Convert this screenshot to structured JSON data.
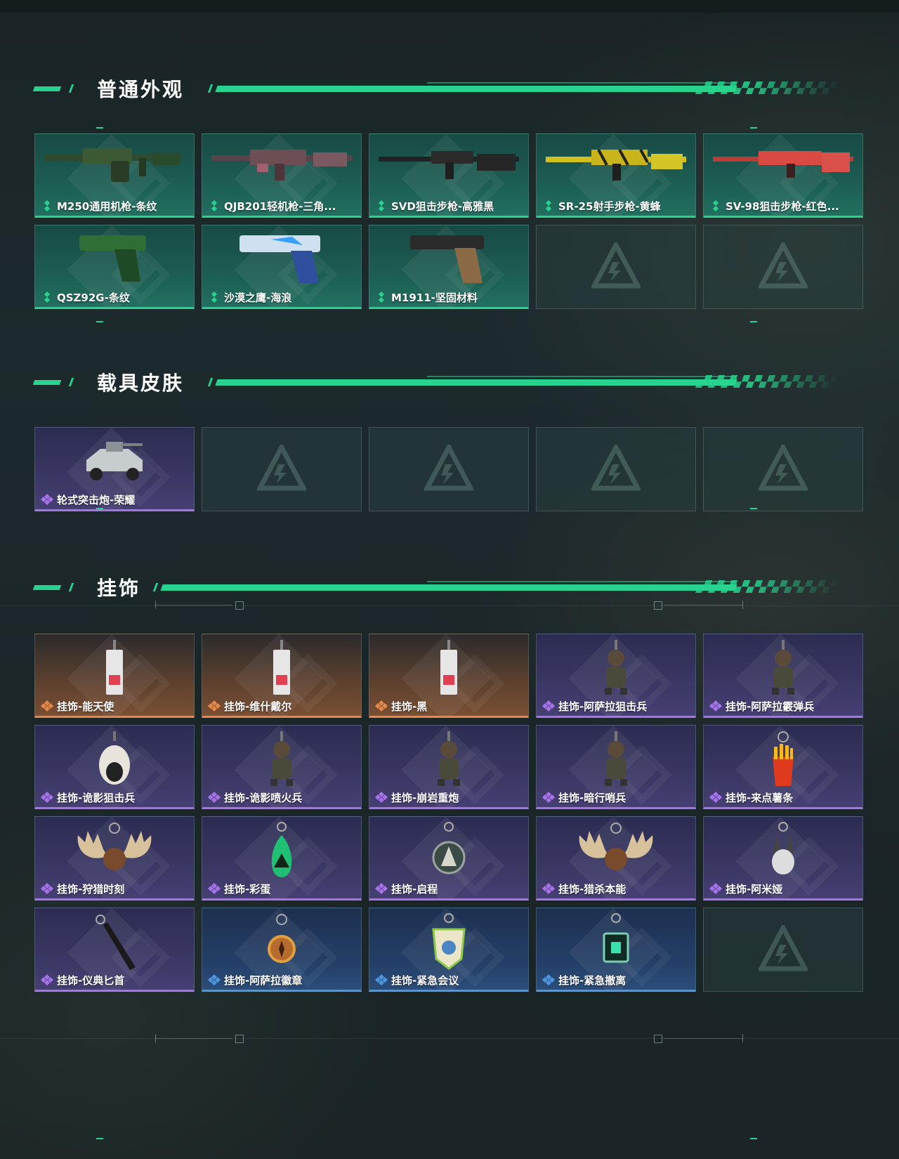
{
  "sections": {
    "normal": {
      "title": "普通外观",
      "items": [
        {
          "label": "M250通用机枪-条纹",
          "rarity": "green",
          "icon": "machine-gun-icon"
        },
        {
          "label": "QJB201轻机枪-三角...",
          "rarity": "green",
          "icon": "light-machine-gun-icon"
        },
        {
          "label": "SVD狙击步枪-高雅黑",
          "rarity": "green",
          "icon": "sniper-rifle-icon"
        },
        {
          "label": "SR-25射手步枪-黄蜂",
          "rarity": "green",
          "icon": "marksman-rifle-icon"
        },
        {
          "label": "SV-98狙击步枪-红色...",
          "rarity": "green",
          "icon": "bolt-rifle-icon"
        },
        {
          "label": "QSZ92G-条纹",
          "rarity": "green",
          "icon": "pistol-icon"
        },
        {
          "label": "沙漠之鹰-海浪",
          "rarity": "green",
          "icon": "desert-eagle-icon"
        },
        {
          "label": "M1911-坚固材料",
          "rarity": "green",
          "icon": "m1911-pistol-icon"
        },
        {
          "label": "",
          "rarity": "empty",
          "icon": "empty-slot-logo-icon"
        },
        {
          "label": "",
          "rarity": "empty",
          "icon": "empty-slot-logo-icon"
        }
      ]
    },
    "vehicle": {
      "title": "载具皮肤",
      "items": [
        {
          "label": "轮式突击炮-荣耀",
          "rarity": "purple",
          "icon": "armored-vehicle-icon"
        },
        {
          "label": "",
          "rarity": "empty",
          "icon": "empty-slot-logo-icon"
        },
        {
          "label": "",
          "rarity": "empty",
          "icon": "empty-slot-logo-icon"
        },
        {
          "label": "",
          "rarity": "empty",
          "icon": "empty-slot-logo-icon"
        },
        {
          "label": "",
          "rarity": "empty",
          "icon": "empty-slot-logo-icon"
        }
      ]
    },
    "charms": {
      "title": "挂饰",
      "items": [
        {
          "label": "挂饰-能天使",
          "rarity": "orange",
          "icon": "card-charm-icon"
        },
        {
          "label": "挂饰-维什戴尔",
          "rarity": "orange",
          "icon": "card-charm-icon"
        },
        {
          "label": "挂饰-黑",
          "rarity": "orange",
          "icon": "card-charm-icon"
        },
        {
          "label": "挂饰-阿萨拉狙击兵",
          "rarity": "purple",
          "icon": "figure-charm-icon"
        },
        {
          "label": "挂饰-阿萨拉霰弹兵",
          "rarity": "purple",
          "icon": "figure-charm-icon"
        },
        {
          "label": "挂饰-诡影狙击兵",
          "rarity": "purple",
          "icon": "bird-charm-icon"
        },
        {
          "label": "挂饰-诡影喷火兵",
          "rarity": "purple",
          "icon": "figure-charm-icon"
        },
        {
          "label": "挂饰-崩岩重炮",
          "rarity": "purple",
          "icon": "figure-charm-icon"
        },
        {
          "label": "挂饰-暗行哨兵",
          "rarity": "purple",
          "icon": "figure-charm-icon"
        },
        {
          "label": "挂饰-来点薯条",
          "rarity": "purple",
          "icon": "fries-charm-icon"
        },
        {
          "label": "挂饰-狩猎时刻",
          "rarity": "purple",
          "icon": "antler-charm-icon"
        },
        {
          "label": "挂饰-彩蛋",
          "rarity": "purple",
          "icon": "egg-charm-icon"
        },
        {
          "label": "挂饰-启程",
          "rarity": "purple",
          "icon": "badge-charm-icon"
        },
        {
          "label": "挂饰-猎杀本能",
          "rarity": "purple",
          "icon": "antler-charm-icon"
        },
        {
          "label": "挂饰-阿米娅",
          "rarity": "purple",
          "icon": "bunny-charm-icon"
        },
        {
          "label": "挂饰-仪典匕首",
          "rarity": "purple",
          "icon": "dagger-charm-icon"
        },
        {
          "label": "挂饰-阿萨拉徽章",
          "rarity": "blue",
          "icon": "medal-charm-icon"
        },
        {
          "label": "挂饰-紧急会议",
          "rarity": "blue",
          "icon": "crest-charm-icon"
        },
        {
          "label": "挂饰-紧急撤离",
          "rarity": "blue",
          "icon": "square-charm-icon"
        },
        {
          "label": "",
          "rarity": "empty",
          "icon": "empty-slot-logo-icon"
        }
      ]
    }
  },
  "colors": {
    "accent": "#27d38e",
    "green": "#27d38e",
    "purple": "#a773ea",
    "orange": "#e58748",
    "blue": "#4f96e0"
  }
}
